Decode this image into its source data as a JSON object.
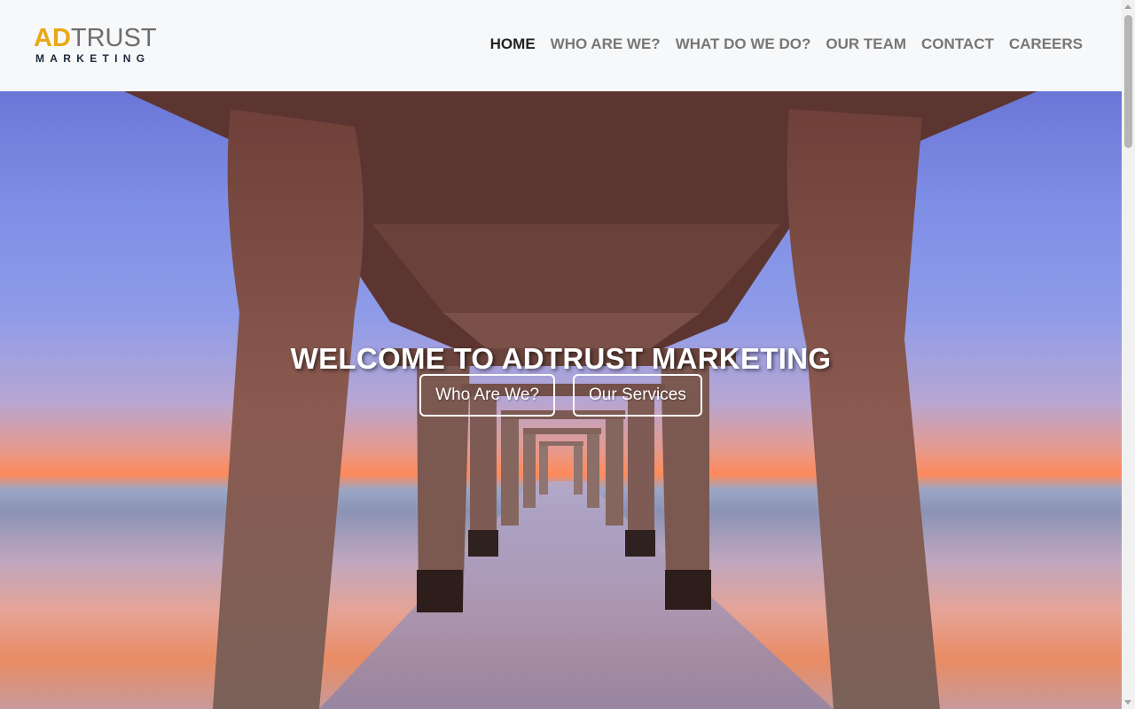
{
  "brand": {
    "logo_part1": "AD",
    "logo_part2": "TRUST",
    "logo_sub": "MARKETING",
    "accent_color": "#e8a917"
  },
  "nav": {
    "items": [
      {
        "label": "HOME",
        "active": true
      },
      {
        "label": "WHO ARE WE?",
        "active": false
      },
      {
        "label": "WHAT DO WE DO?",
        "active": false
      },
      {
        "label": "OUR TEAM",
        "active": false
      },
      {
        "label": "CONTACT",
        "active": false
      },
      {
        "label": "CAREERS",
        "active": false
      }
    ]
  },
  "hero": {
    "title": "WELCOME TO ADTRUST MARKETING",
    "primary_button": "Who Are We?",
    "secondary_button": "Our Services",
    "background": "pier-at-sunset-photo"
  }
}
